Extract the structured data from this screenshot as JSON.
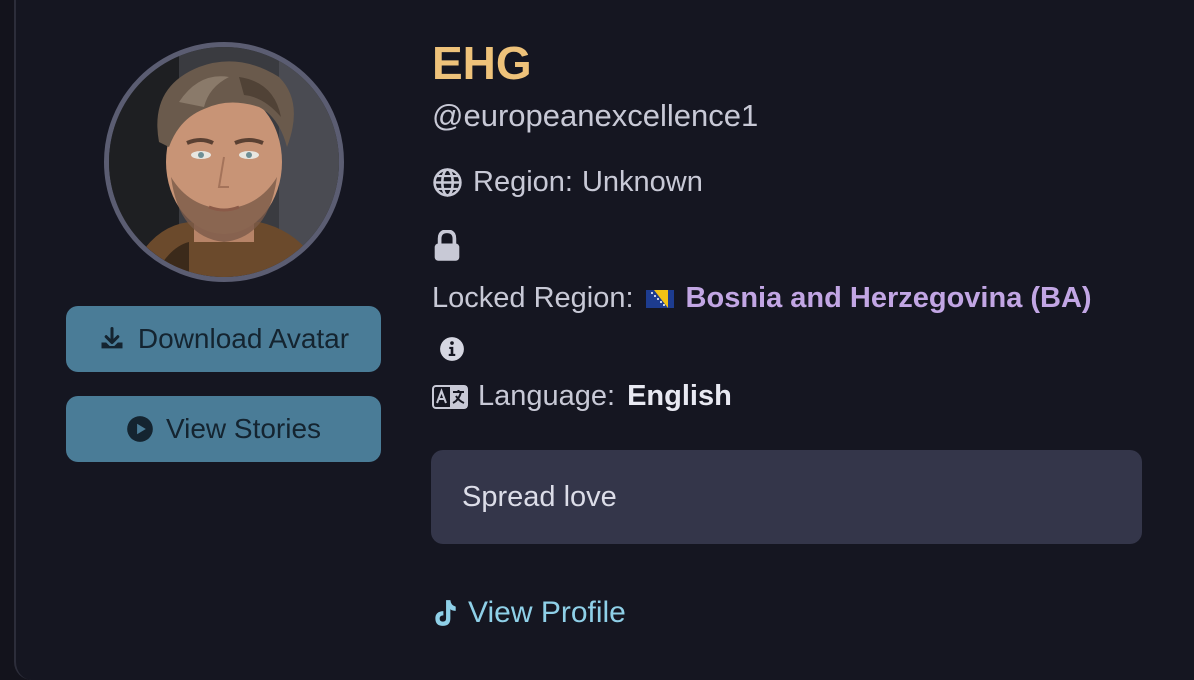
{
  "profile": {
    "display_name": "EHG",
    "handle": "@europeanexcellence1",
    "region_label": "Region:",
    "region_value": "Unknown",
    "locked_region_label": "Locked Region:",
    "locked_region_value": "Bosnia and Herzegovina (BA)",
    "language_label": "Language:",
    "language_value": "English",
    "bio": "Spread love"
  },
  "actions": {
    "download_avatar": "Download Avatar",
    "view_stories": "View Stories",
    "view_profile": "View Profile"
  },
  "icons": {
    "download": "download-icon",
    "stories": "play-circle-icon",
    "region": "globe-icon",
    "lock": "lock-icon",
    "flag": "bosnia-flag-icon",
    "info": "info-icon",
    "language": "language-icon",
    "tiktok": "tiktok-icon"
  },
  "colors": {
    "name": "#eec27a",
    "locked_region": "#c2a6e4",
    "button_bg": "#4a7c97",
    "link": "#8fd0e8",
    "bio_bg": "#34364a"
  }
}
